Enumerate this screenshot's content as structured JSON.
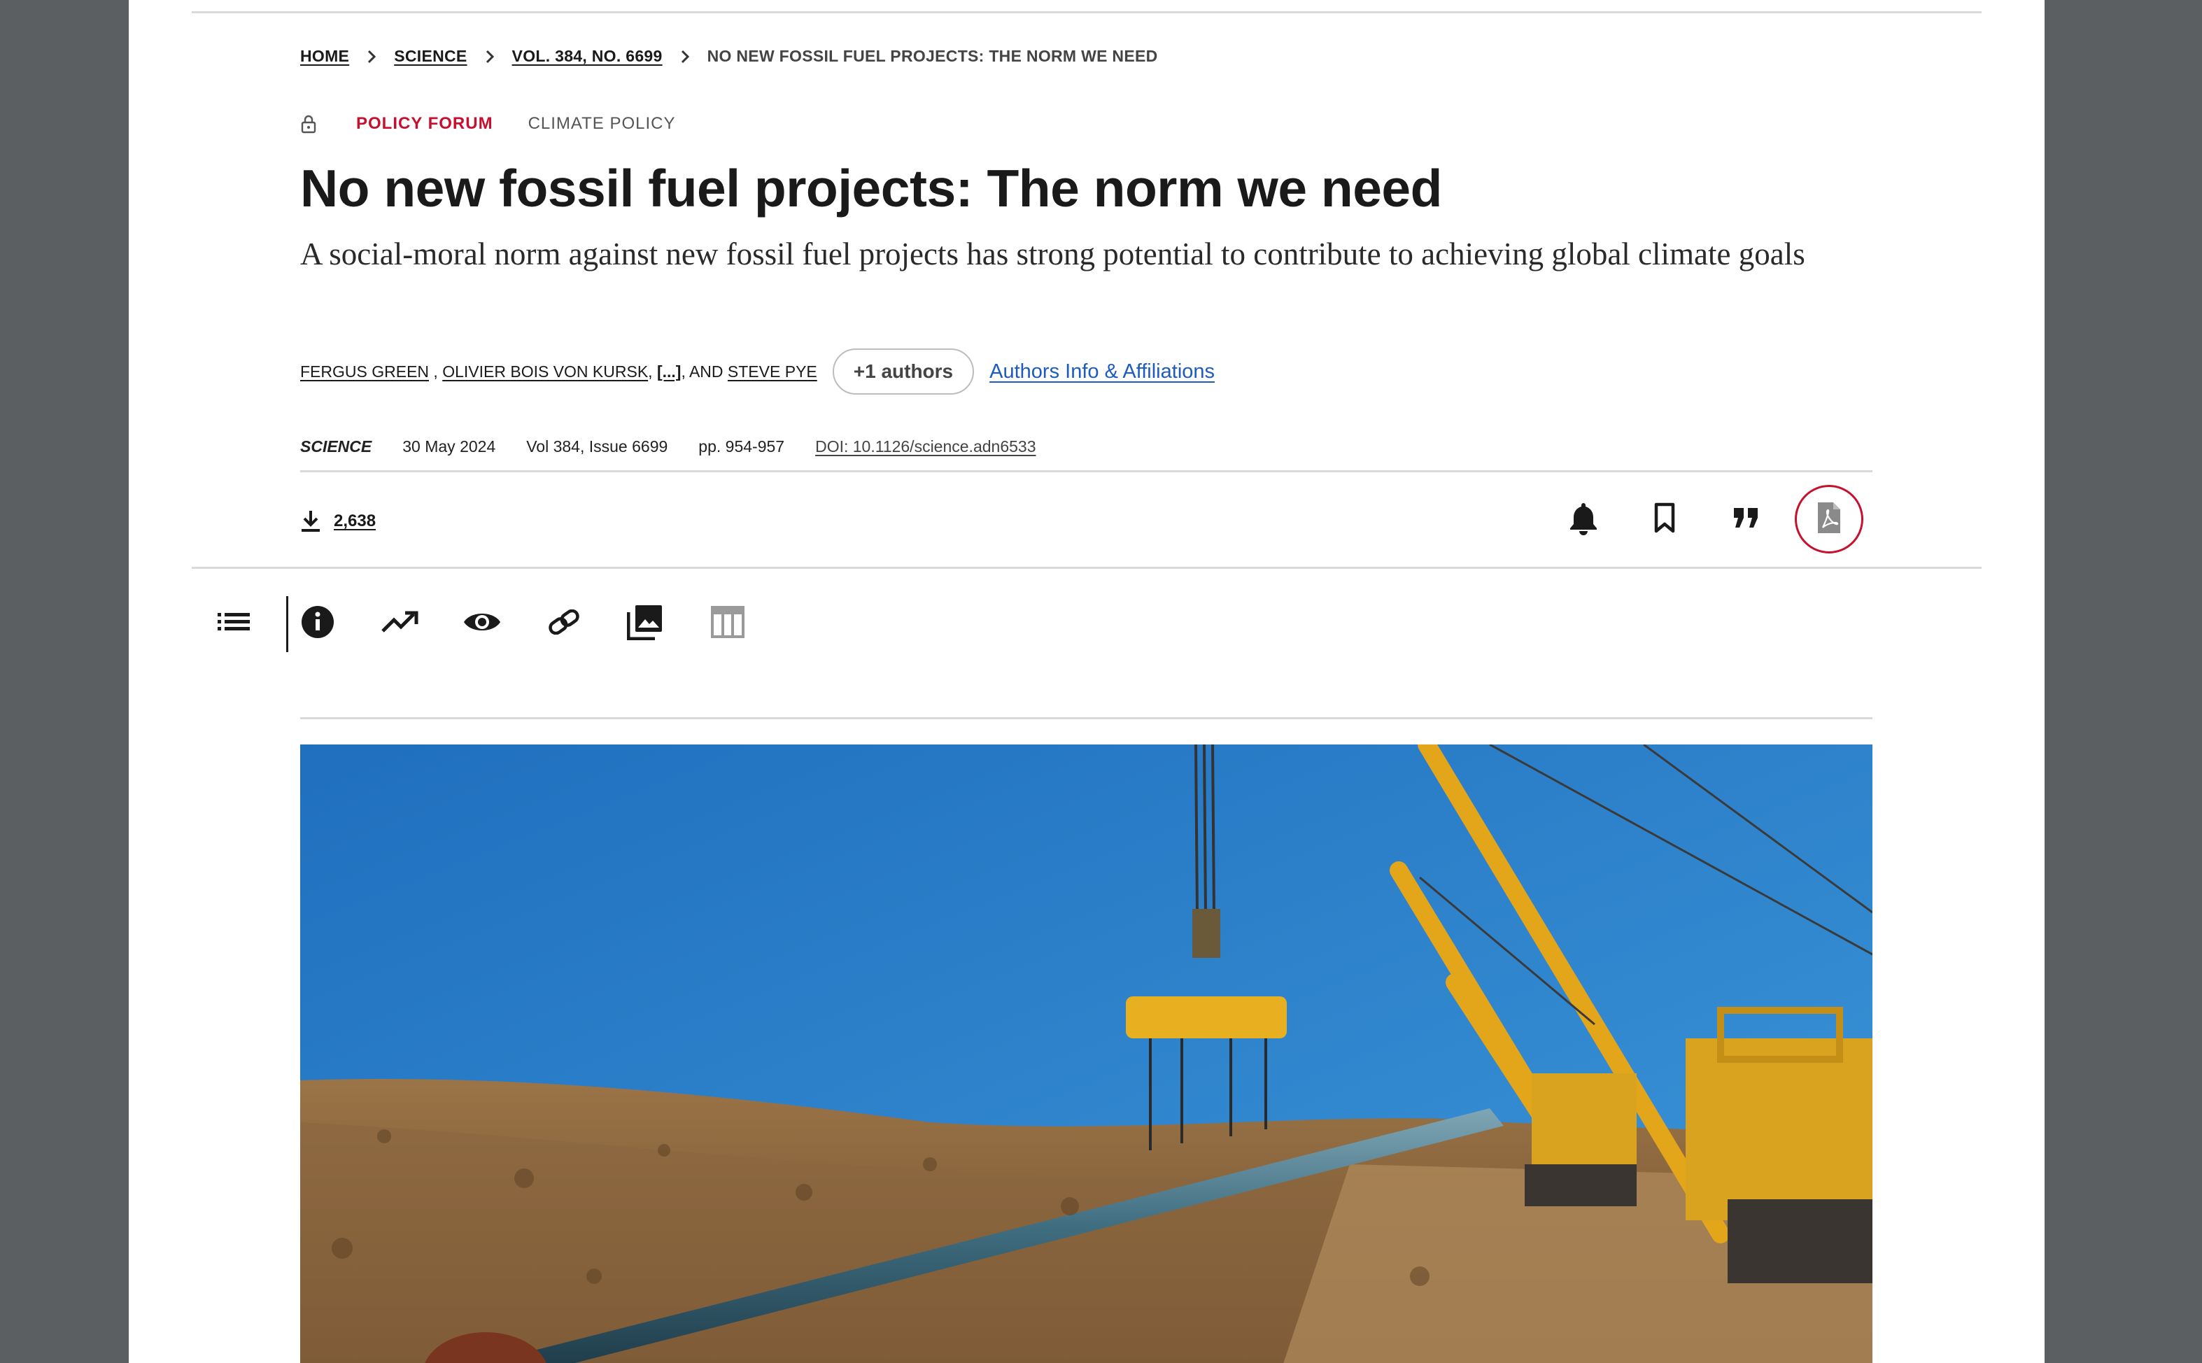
{
  "breadcrumb": {
    "home": "HOME",
    "science": "SCIENCE",
    "issue": "VOL. 384, NO. 6699",
    "current": "NO NEW FOSSIL FUEL PROJECTS: THE NORM WE NEED"
  },
  "kicker": {
    "section": "POLICY FORUM",
    "topic": "CLIMATE POLICY",
    "access_icon": "lock-icon"
  },
  "article": {
    "title": "No new fossil fuel projects: The norm we need",
    "subtitle": "A social-moral norm against new fossil fuel projects has strong potential to contribute to achieving global climate goals"
  },
  "authors": {
    "author1": "FERGUS GREEN",
    "sep1": " , ",
    "author2": "OLIVIER BOIS VON KURSK",
    "sep2": ", ",
    "ellipsis": "[...]",
    "and": ", AND ",
    "author3": "STEVE PYE",
    "more_button": "+1 authors",
    "affiliations_link": "Authors Info & Affiliations"
  },
  "meta": {
    "journal": "SCIENCE",
    "date": "30 May 2024",
    "volume": "Vol 384, Issue 6699",
    "pages": "pp. 954-957",
    "doi": "DOI: 10.1126/science.adn6533"
  },
  "stats": {
    "downloads": "2,638"
  },
  "actions": [
    "bell-icon",
    "bookmark-icon",
    "quote-icon",
    "pdf-icon"
  ],
  "toolbar": [
    "contents-list-icon",
    "info-icon",
    "metrics-trend-icon",
    "view-eye-icon",
    "link-icon",
    "figures-gallery-icon",
    "tables-icon"
  ],
  "colors": {
    "accent_red": "#c8102e",
    "link_blue": "#1e5bbf",
    "sky": "#2d86d4",
    "pipe_line": "#3f6d80",
    "machinery_yellow": "#e8b020",
    "soil": "#a0784a"
  }
}
